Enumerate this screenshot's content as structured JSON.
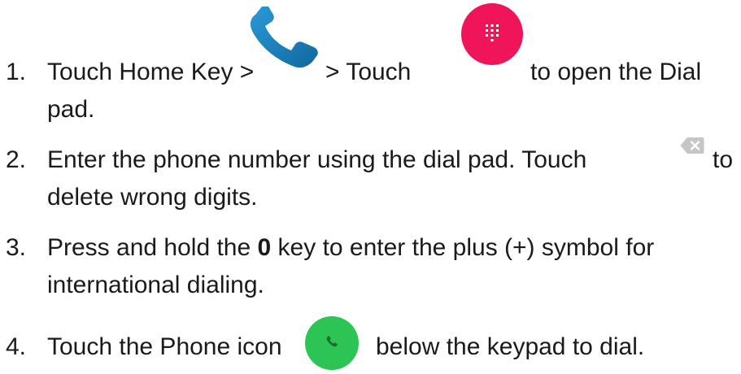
{
  "steps": [
    {
      "number": "1.",
      "text_a": "Touch Home Key >",
      "text_b": "> Touch",
      "text_c": "to open the Dial",
      "text_d": "pad."
    },
    {
      "number": "2.",
      "text_a": "Enter the phone number using the dial pad. Touch",
      "text_b": "to",
      "text_c": "delete wrong digits."
    },
    {
      "number": "3.",
      "text_a": "Press and hold the",
      "key": "0",
      "text_b": "key to enter the plus (+) symbol for",
      "text_c": "international dialing."
    },
    {
      "number": "4.",
      "text_a": "Touch the Phone icon",
      "text_b": "below the keypad to dial."
    }
  ],
  "icons": {
    "phone_app": "phone-handset-icon",
    "dialpad": "dialpad-button-icon",
    "backspace": "backspace-delete-icon",
    "call": "call-button-icon"
  },
  "colors": {
    "phone_blue": "#1e88c8",
    "dialpad_pink": "#f0145a",
    "backspace_grey": "#c6c6c6",
    "call_green": "#2bc455"
  }
}
